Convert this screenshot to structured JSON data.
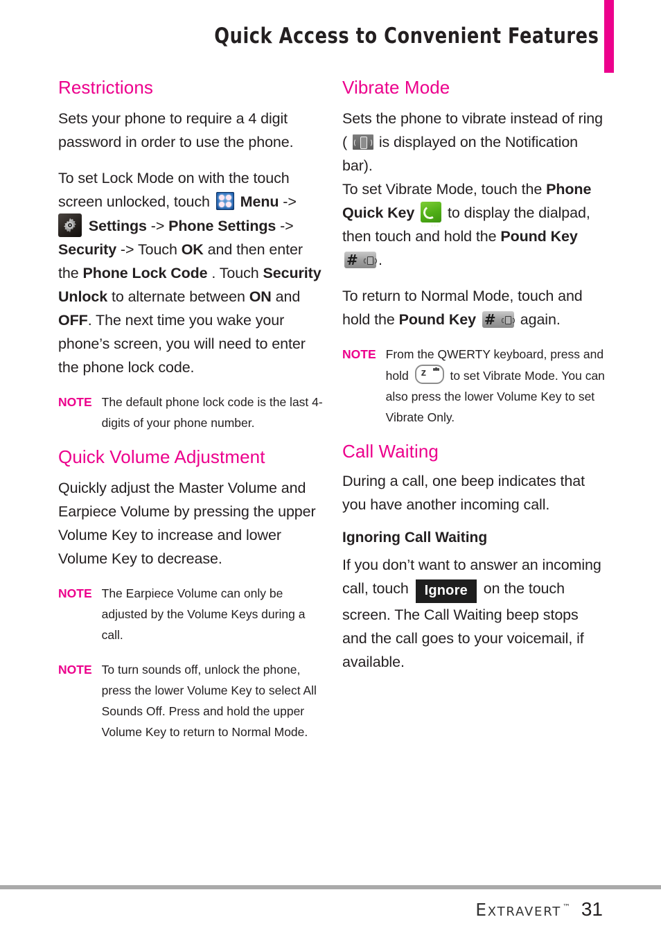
{
  "header": {
    "title": "Quick Access to Convenient Features",
    "accent_color": "#ec008c"
  },
  "left_column": {
    "section1": {
      "title": "Restrictions",
      "p1": "Sets your phone to require a 4 digit password in order to use the phone.",
      "p2_part1": "To set Lock Mode on with the touch screen unlocked, touch",
      "p2_menu": "Menu",
      "p2_arrow1": "->",
      "p2_settings": "Settings",
      "p2_arrow2": "->",
      "p2_phone_settings": "Phone Settings",
      "p2_arrow3": "->",
      "p2_security": "Security",
      "p2_arrow4": "->",
      "p2_touch": "Touch",
      "p2_ok": "OK",
      "p2_andthen": "and then enter the",
      "p2_lockcode": "Phone Lock Code",
      "p2_touch2": ". Touch",
      "p2_secunlock": "Security Unlock",
      "p2_alternate": "to alternate between",
      "p2_on": "ON",
      "p2_and": "and",
      "p2_off": "OFF",
      "p2_tail": ". The next time you wake your phone’s screen, you will need to enter the phone lock code.",
      "note_label": "NOTE",
      "note_body": "The default phone lock code is the last 4-digits of your phone number."
    },
    "section2": {
      "title": "Quick Volume Adjustment",
      "p1": "Quickly adjust the Master Volume and Earpiece Volume by pressing the upper Volume Key to increase and lower Volume Key to decrease.",
      "note1_label": "NOTE",
      "note1_body": "The Earpiece Volume can only be adjusted by the Volume Keys during a call.",
      "note2_label": "NOTE",
      "note2_body": "To turn sounds off, unlock the phone, press the lower Volume Key to select All Sounds Off. Press and hold the upper Volume Key to return to Normal Mode."
    }
  },
  "right_column": {
    "section1": {
      "title": "Vibrate Mode",
      "p1_part1": "Sets the phone to vibrate instead of ring (",
      "p1_part2": "is displayed on the Notification bar).",
      "p1_part3": "To set Vibrate Mode, touch the",
      "p1_quickkey": "Phone Quick Key",
      "p1_part4": "to display the dialpad, then touch and hold the",
      "p1_poundkey": "Pound Key",
      "p1_period": ".",
      "p2_part1": "To return to Normal Mode, touch and hold the",
      "p2_poundkey": "Pound Key",
      "p2_part2": "again.",
      "note_label": "NOTE",
      "note_body_part1": "From the QWERTY keyboard, press and hold",
      "note_body_part2": "to set Vibrate Mode. You can also press the lower Volume Key to set Vibrate Only."
    },
    "section2": {
      "title": "Call Waiting",
      "p1": "During a call, one beep indicates that you have another incoming call.",
      "subtitle": "Ignoring Call Waiting",
      "p2_part1": "If you don’t want to answer an incoming call, touch",
      "p2_ignore": "Ignore",
      "p2_part2": "on the touch screen. The Call Waiting beep stops and the call goes to your voicemail, if available."
    }
  },
  "footer": {
    "brand_first": "E",
    "brand_rest": "xtravert",
    "trademark": "™",
    "page_number": "31"
  },
  "icons": {
    "menu": "menu-grid-icon",
    "settings": "settings-gear-icon",
    "vibrate": "vibrate-status-icon",
    "phone_quick": "phone-quick-key-icon",
    "pound": "pound-key-icon",
    "zkey": "qwerty-z-key-icon"
  }
}
